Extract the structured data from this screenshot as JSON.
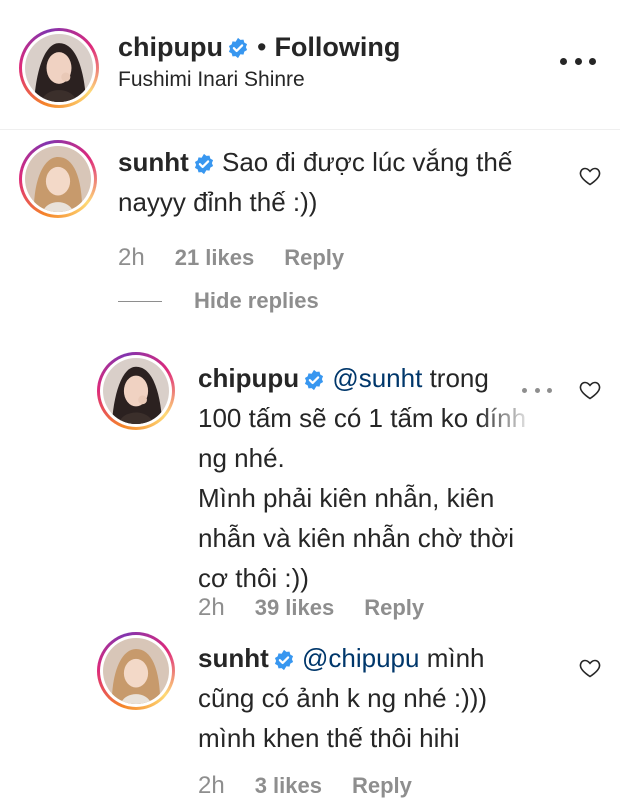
{
  "post_header": {
    "username": "chipupu",
    "separator": "•",
    "follow_label": "Following",
    "location": "Fushimi Inari Shinre"
  },
  "comments": [
    {
      "username": "sunht",
      "text_lines": [
        "Sao đi được lúc vắng thế",
        "nayyy đỉnh thế :))"
      ],
      "time": "2h",
      "likes": "21 likes",
      "reply_label": "Reply"
    }
  ],
  "hide_replies_label": "Hide replies",
  "replies": [
    {
      "username": "chipupu",
      "mention": "@sunht",
      "first_line_rest": "trong",
      "text_lines": [
        "100 tấm sẽ có 1 tấm ko dính",
        "ng nhé.",
        "Mình phải kiên nhẫn, kiên",
        "nhẫn và kiên nhẫn chờ thời",
        "cơ thôi :))"
      ],
      "time": "2h",
      "likes": "39 likes",
      "reply_label": "Reply"
    },
    {
      "username": "sunht",
      "mention": "@chipupu",
      "first_line_rest": "mình",
      "text_lines": [
        "cũng có ảnh k ng nhé :)))",
        "mình khen thế thôi hihi"
      ],
      "time": "2h",
      "likes": "3 likes",
      "reply_label": "Reply"
    }
  ],
  "colors": {
    "text": "#262626",
    "secondary": "#8e8e8e",
    "mention": "#00376b",
    "verified": "#3897f0"
  },
  "icons": [
    "verified-badge-icon",
    "more-options-icon",
    "heart-icon"
  ]
}
